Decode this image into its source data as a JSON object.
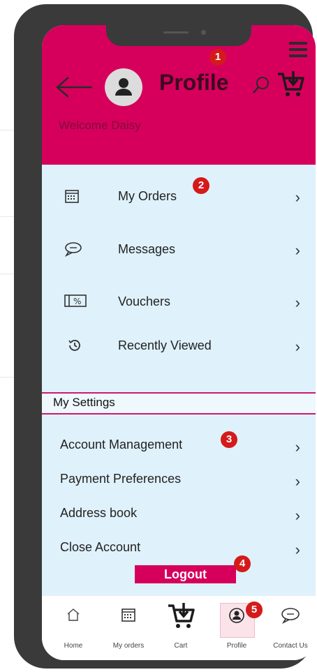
{
  "header": {
    "title": "Profile",
    "welcome": "Welcome Daisy",
    "icons": [
      "hamburger-icon",
      "back-arrow-icon",
      "avatar-icon",
      "search-icon",
      "cart-icon"
    ]
  },
  "badges": [
    "1",
    "2",
    "3",
    "4",
    "5"
  ],
  "menu": {
    "items": [
      {
        "label": "My Orders",
        "icon": "calendar-icon"
      },
      {
        "label": "Messages",
        "icon": "chat-icon"
      },
      {
        "label": "Vouchers",
        "icon": "voucher-icon"
      },
      {
        "label": "Recently Viewed",
        "icon": "history-icon"
      }
    ]
  },
  "settings": {
    "title": "My Settings",
    "items": [
      {
        "label": "Account Management"
      },
      {
        "label": "Payment Preferences"
      },
      {
        "label": "Address book"
      },
      {
        "label": "Close Account"
      }
    ],
    "logout_label": "Logout"
  },
  "bottom_nav": {
    "items": [
      {
        "label": "Home",
        "icon": "home-icon"
      },
      {
        "label": "My orders",
        "icon": "calendar-icon"
      },
      {
        "label": "Cart",
        "icon": "cart-icon"
      },
      {
        "label": "Profile",
        "icon": "avatar-icon"
      },
      {
        "label": "Contact Us",
        "icon": "chat-icon"
      }
    ],
    "active": "Profile"
  },
  "colors": {
    "brand": "#d6005c",
    "screen_bg": "#dff1fb",
    "badge": "#d41a1a",
    "phone_frame": "#3a3a3a"
  }
}
